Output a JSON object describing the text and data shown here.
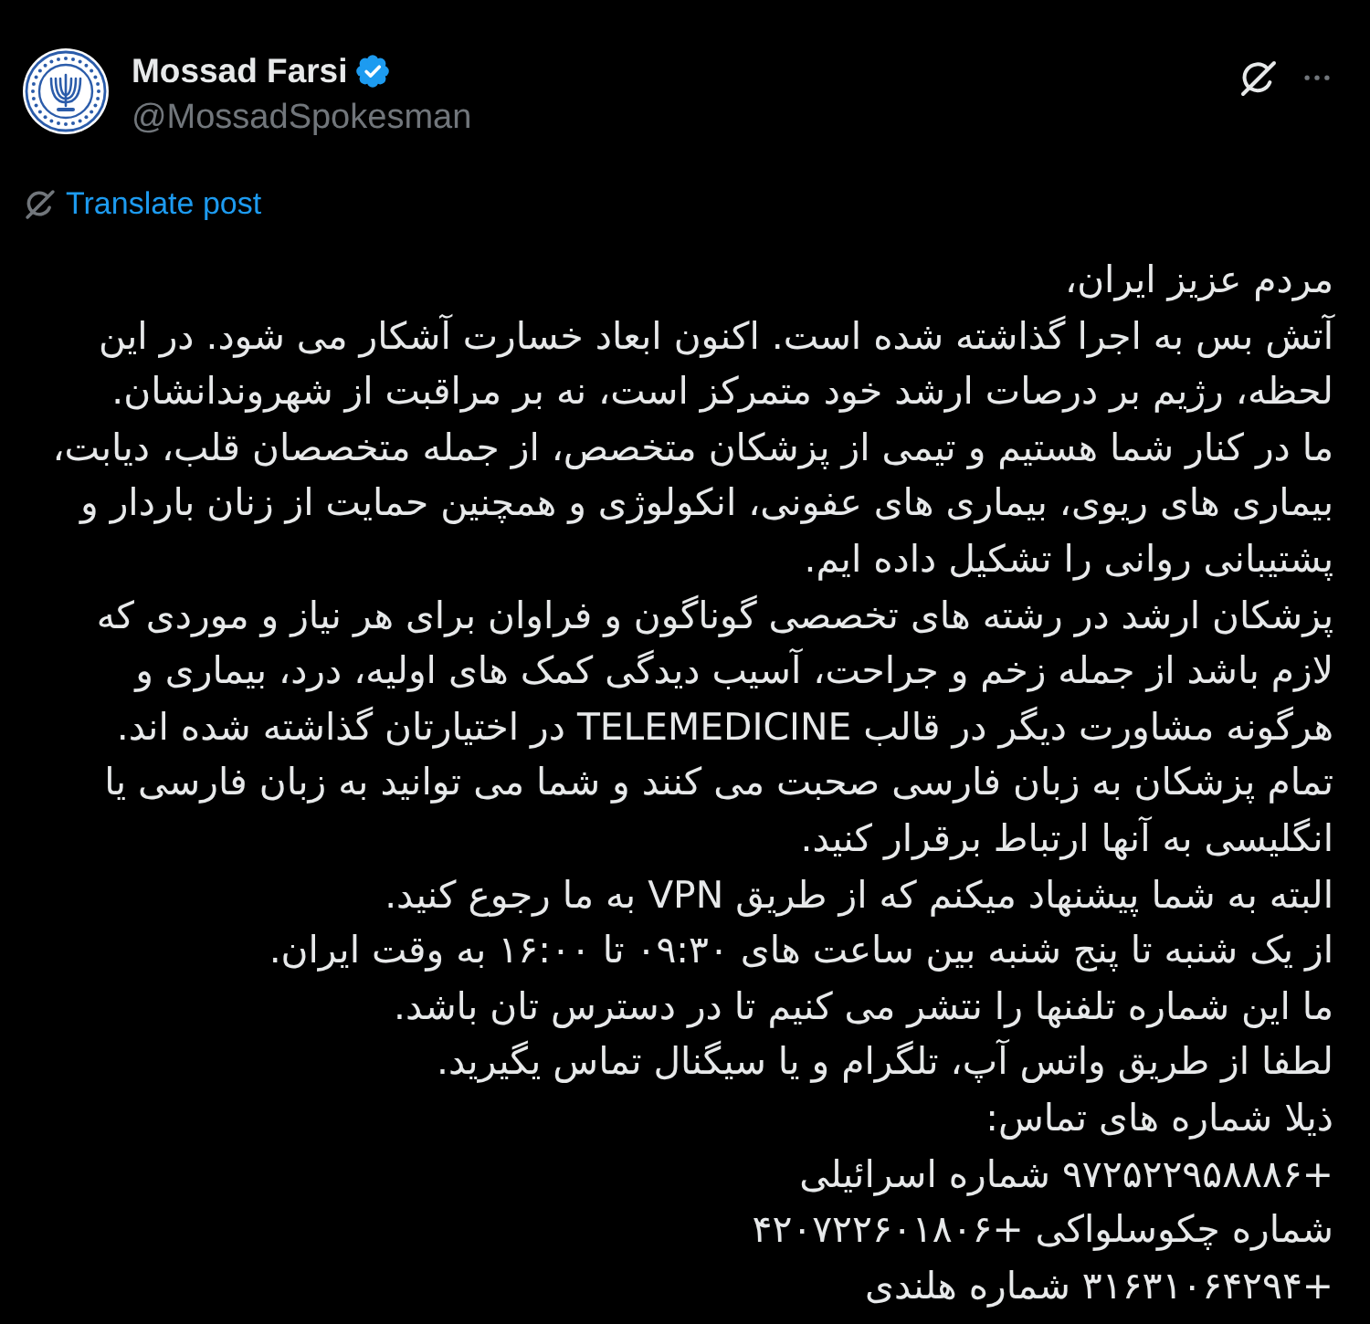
{
  "post": {
    "author": {
      "name": "Mossad Farsi",
      "verified": true,
      "handle": "@MossadSpokesman"
    },
    "translate_link": "Translate post",
    "paragraphs": [
      "مردم عزیز ایران،",
      "آتش بس به اجرا گذاشته شده است. اکنون ابعاد خسارت آشکار می شود. در این لحظه، رژیم بر درصات ارشد خود متمرکز است، نه بر مراقبت از شهروندانشان.",
      "ما در کنار شما هستیم و تیمی از پزشکان متخصص، از جمله متخصصان قلب، دیابت، بیماری های ریوی، بیماری های عفونی، انکولوژی و همچنین حمایت از زنان باردار و پشتیبانی روانی را تشکیل داده ایم.",
      "پزشکان ارشد در رشته های تخصصی گوناگون و فراوان برای هر نیاز و موردی که لازم باشد از جمله زخم و جراحت، آسیب دیدگی کمک های اولیه، درد، بیماری و هرگونه مشاورت دیگر در قالب TELEMEDICINE در اختیارتان گذاشته شده اند.",
      "تمام پزشکان به زبان فارسی صحبت می کنند و شما می توانید به زبان فارسی یا انگلیسی به آنها ارتباط برقرار کنید.",
      "البته به شما پیشنهاد میکنم که از طریق VPN به ما رجوع کنید.",
      "از یک شنبه تا پنج شنبه بین ساعت های ۰۹:۳۰ تا ۱۶:۰۰ به وقت ایران.",
      "ما این شماره تلفنها را نتشر می کنیم تا در دسترس تان باشد.",
      "لطفا از طریق واتس آپ، تلگرام و یا سیگنال تماس یگیرید.",
      "ذیلا شماره های تماس:",
      "+۹۷۲۵۲۲۹۵۸۸۸۶ شماره اسرائیلی",
      "شماره چکوسلواکی +۴۲۰۷۲۲۶۰۱۸۰۶",
      "+۳۱۶۳۱۰۶۴۲۹۴ شماره هلندی"
    ]
  }
}
